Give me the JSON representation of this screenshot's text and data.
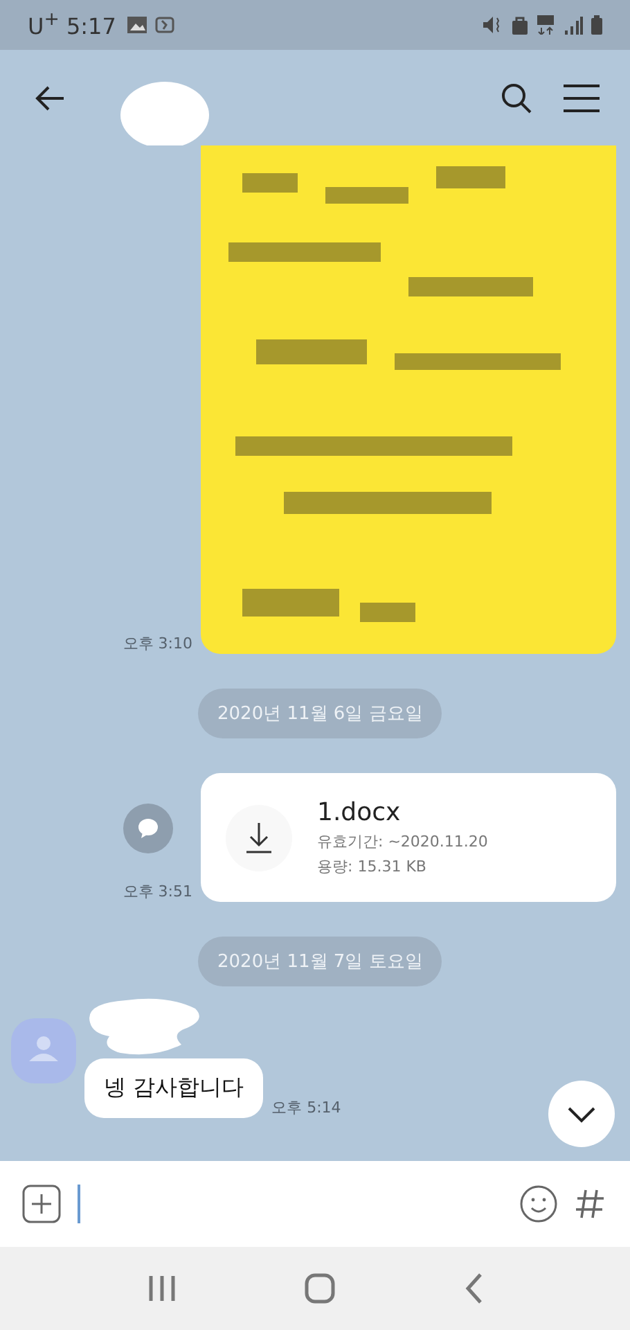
{
  "status_bar": {
    "carrier": "U$^{+}$",
    "time": "5:17"
  },
  "messages": [
    {
      "time": "오후 3:10"
    },
    {
      "kind": "date",
      "text": "2020년 11월 6일 금요일"
    },
    {
      "kind": "file",
      "file_name": "1.docx",
      "expiry": "유효기간: ~2020.11.20",
      "size": "용량: 15.31 KB",
      "time": "오후 3:51"
    },
    {
      "kind": "date",
      "text": "2020년 11월 7일 토요일"
    },
    {
      "kind": "text",
      "text": "넹 감사합니다",
      "time": "오후 5:14"
    }
  ]
}
